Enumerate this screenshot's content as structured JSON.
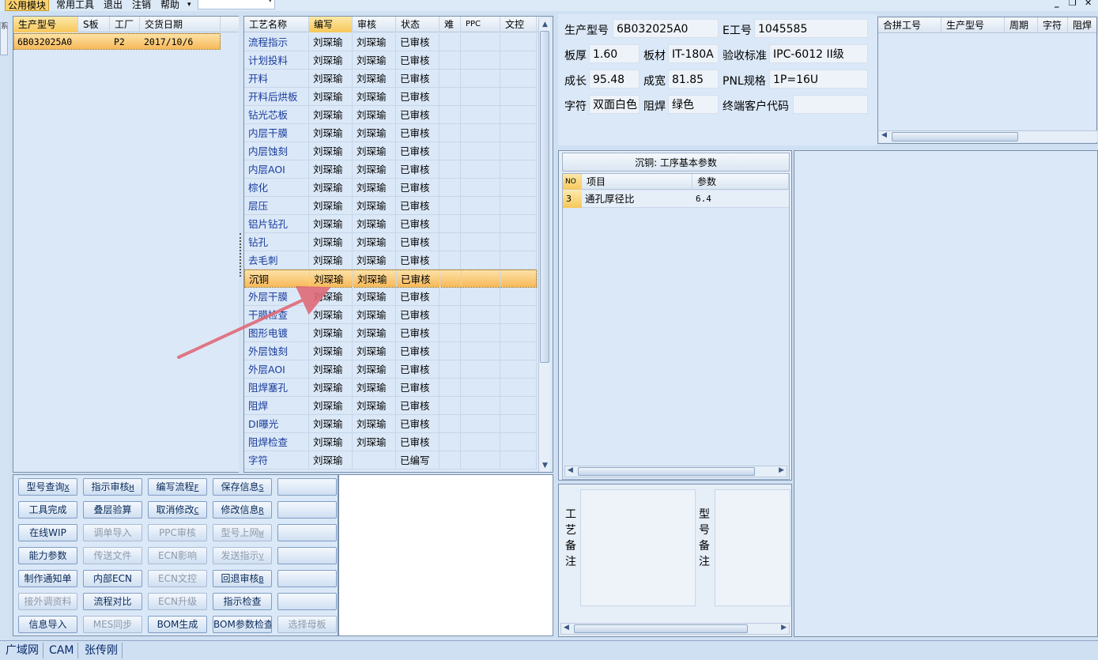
{
  "menubar": {
    "items": [
      "公用模块",
      "常用工具",
      "退出",
      "注销",
      "帮助"
    ],
    "combo_value": ""
  },
  "side_tab": "系",
  "left_grid": {
    "columns": [
      "生产型号",
      "S板",
      "工厂",
      "交货日期"
    ],
    "rows": [
      [
        "6B032025A0",
        "",
        "P2",
        "2017/10/6"
      ]
    ]
  },
  "process_grid": {
    "columns": [
      "工艺名称",
      "编写",
      "审核",
      "状态",
      "难",
      "PPC",
      "文控"
    ],
    "rows": [
      [
        "流程指示",
        "刘琛瑜",
        "刘琛瑜",
        "已审核"
      ],
      [
        "计划投料",
        "刘琛瑜",
        "刘琛瑜",
        "已审核"
      ],
      [
        "开料",
        "刘琛瑜",
        "刘琛瑜",
        "已审核"
      ],
      [
        "开料后烘板",
        "刘琛瑜",
        "刘琛瑜",
        "已审核"
      ],
      [
        "钻光芯板",
        "刘琛瑜",
        "刘琛瑜",
        "已审核"
      ],
      [
        "内层干膜",
        "刘琛瑜",
        "刘琛瑜",
        "已审核"
      ],
      [
        "内层蚀刻",
        "刘琛瑜",
        "刘琛瑜",
        "已审核"
      ],
      [
        "内层AOI",
        "刘琛瑜",
        "刘琛瑜",
        "已审核"
      ],
      [
        "棕化",
        "刘琛瑜",
        "刘琛瑜",
        "已审核"
      ],
      [
        "层压",
        "刘琛瑜",
        "刘琛瑜",
        "已审核"
      ],
      [
        "铝片钻孔",
        "刘琛瑜",
        "刘琛瑜",
        "已审核"
      ],
      [
        "钻孔",
        "刘琛瑜",
        "刘琛瑜",
        "已审核"
      ],
      [
        "去毛刺",
        "刘琛瑜",
        "刘琛瑜",
        "已审核"
      ],
      [
        "沉铜",
        "刘琛瑜",
        "刘琛瑜",
        "已审核"
      ],
      [
        "外层干膜",
        "刘琛瑜",
        "刘琛瑜",
        "已审核"
      ],
      [
        "干膜检查",
        "刘琛瑜",
        "刘琛瑜",
        "已审核"
      ],
      [
        "图形电镀",
        "刘琛瑜",
        "刘琛瑜",
        "已审核"
      ],
      [
        "外层蚀刻",
        "刘琛瑜",
        "刘琛瑜",
        "已审核"
      ],
      [
        "外层AOI",
        "刘琛瑜",
        "刘琛瑜",
        "已审核"
      ],
      [
        "阻焊塞孔",
        "刘琛瑜",
        "刘琛瑜",
        "已审核"
      ],
      [
        "阻焊",
        "刘琛瑜",
        "刘琛瑜",
        "已审核"
      ],
      [
        "DI曝光",
        "刘琛瑜",
        "刘琛瑜",
        "已审核"
      ],
      [
        "阻焊检查",
        "刘琛瑜",
        "刘琛瑜",
        "已审核"
      ],
      [
        "字符",
        "刘琛瑜",
        "",
        "已编写"
      ]
    ],
    "selected_index": 13
  },
  "buttons": [
    [
      {
        "label": "型号查询",
        "sc": "X",
        "enabled": true
      },
      {
        "label": "指示审核",
        "sc": "H",
        "enabled": true
      },
      {
        "label": "编写流程",
        "sc": "F",
        "enabled": true
      },
      {
        "label": "保存信息",
        "sc": "S",
        "enabled": true
      },
      {
        "label": "",
        "sc": "",
        "enabled": true
      }
    ],
    [
      {
        "label": "工具完成",
        "sc": "",
        "enabled": true
      },
      {
        "label": "叠层验算",
        "sc": "",
        "enabled": true
      },
      {
        "label": "取消修改",
        "sc": "C",
        "enabled": true
      },
      {
        "label": "修改信息",
        "sc": "R",
        "enabled": true
      },
      {
        "label": "",
        "sc": "",
        "enabled": true
      }
    ],
    [
      {
        "label": "在线WIP",
        "sc": "",
        "enabled": true
      },
      {
        "label": "调单导入",
        "sc": "",
        "enabled": false
      },
      {
        "label": "PPC审核",
        "sc": "",
        "enabled": false
      },
      {
        "label": "型号上网",
        "sc": "W",
        "enabled": false
      },
      {
        "label": "",
        "sc": "",
        "enabled": true
      }
    ],
    [
      {
        "label": "能力参数",
        "sc": "",
        "enabled": true
      },
      {
        "label": "传送文件",
        "sc": "",
        "enabled": false
      },
      {
        "label": "ECN影响",
        "sc": "",
        "enabled": false
      },
      {
        "label": "发送指示",
        "sc": "V",
        "enabled": false
      },
      {
        "label": "",
        "sc": "",
        "enabled": true
      }
    ],
    [
      {
        "label": "制作通知单",
        "sc": "",
        "enabled": true
      },
      {
        "label": "内部ECN",
        "sc": "",
        "enabled": true
      },
      {
        "label": "ECN文控",
        "sc": "",
        "enabled": false
      },
      {
        "label": "回退审核",
        "sc": "B",
        "enabled": true
      },
      {
        "label": "",
        "sc": "",
        "enabled": true
      }
    ],
    [
      {
        "label": "接外调资料",
        "sc": "",
        "enabled": false
      },
      {
        "label": "流程对比",
        "sc": "",
        "enabled": true
      },
      {
        "label": "ECN升级",
        "sc": "",
        "enabled": false
      },
      {
        "label": "指示检查",
        "sc": "",
        "enabled": true
      },
      {
        "label": "",
        "sc": "",
        "enabled": true
      }
    ],
    [
      {
        "label": "信息导入",
        "sc": "",
        "enabled": true
      },
      {
        "label": "MES同步",
        "sc": "",
        "enabled": false
      },
      {
        "label": "BOM生成",
        "sc": "",
        "enabled": true
      },
      {
        "label": "BOM参数检查",
        "sc": "",
        "enabled": true
      },
      {
        "label": "选择母板",
        "sc": "",
        "enabled": false
      }
    ]
  ],
  "info": {
    "model_label": "生产型号",
    "model_value": "6B032025A0",
    "eno_label": "E工号",
    "eno_value": "1045585",
    "thick_label": "板厚",
    "thick_value": "1.60",
    "material_label": "板材",
    "material_value": "IT-180A",
    "std_label": "验收标准",
    "std_value": "IPC-6012 II级",
    "length_label": "成长",
    "length_value": "95.48",
    "width_label": "成宽",
    "width_value": "81.85",
    "pnl_label": "PNL规格",
    "pnl_value": "1P=16U",
    "char_label": "字符",
    "char_value": "双面白色",
    "mask_label": "阻焊",
    "mask_value": "绿色",
    "cust_label": "终端客户代码",
    "cust_value": ""
  },
  "merge_grid": {
    "columns": [
      "合拼工号",
      "生产型号",
      "周期",
      "字符",
      "阻焊"
    ]
  },
  "params": {
    "title": "沉铜: 工序基本参数",
    "columns": [
      "NO",
      "项目",
      "参数"
    ],
    "rows": [
      [
        "3",
        "通孔厚径比",
        "6.4"
      ]
    ]
  },
  "notes": {
    "process_label": "工艺备注",
    "model_label": "型号备注",
    "process_text": "",
    "model_text": ""
  },
  "statusbar": [
    "广域网",
    "CAM",
    "张传刚"
  ],
  "colors": {
    "selection": "#f7b95a",
    "panel_bg": "#dbe8f7",
    "arrow": "#e06a78",
    "link_text": "#1a3c9c"
  }
}
